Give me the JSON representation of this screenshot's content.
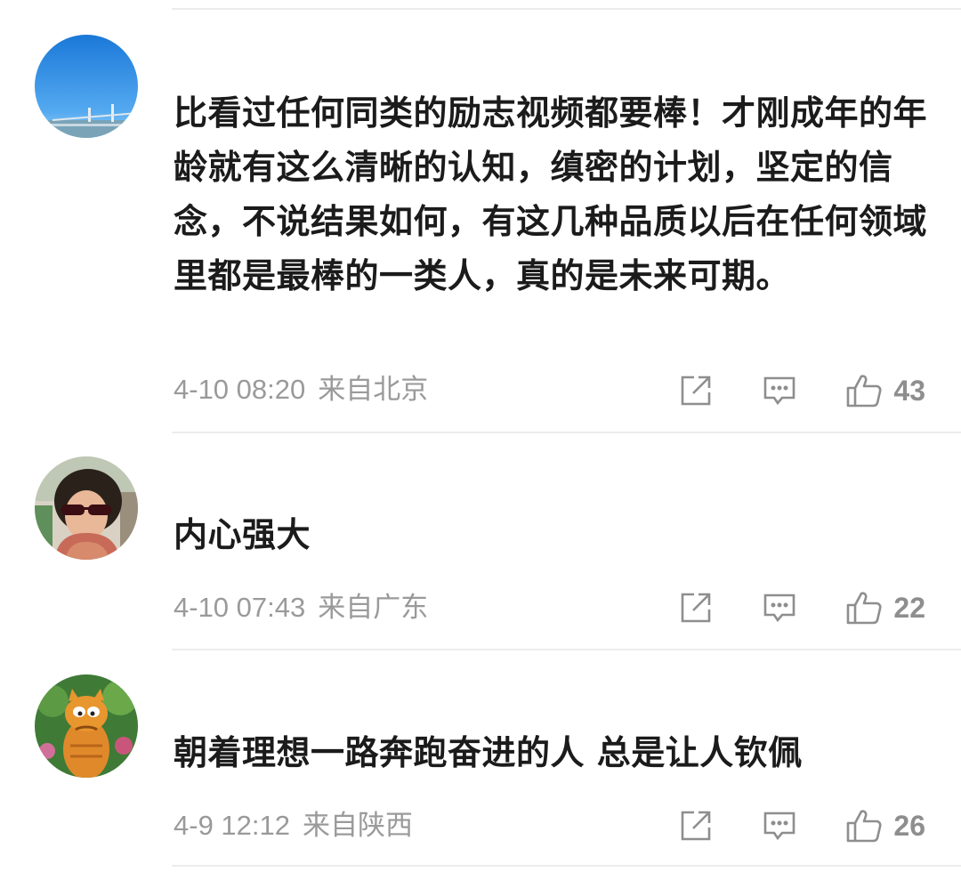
{
  "comments": [
    {
      "avatar": "sky-bridge-photo",
      "text": "比看过任何同类的励志视频都要棒！才刚成年的年龄就有这么清晰的认知，缜密的计划，坚定的信念，不说结果如何，有这几种品质以后在任何领域里都是最棒的一类人，真的是未来可期。",
      "time": "4-10 08:20",
      "location": "来自北京",
      "likes": "43"
    },
    {
      "avatar": "girl-with-sunglasses-photo",
      "text": "内心强大",
      "time": "4-10 07:43",
      "location": "来自广东",
      "likes": "22"
    },
    {
      "avatar": "garfield-cat-photo",
      "text": "朝着理想一路奔跑奋进的人 总是让人钦佩",
      "time": "4-9 12:12",
      "location": "来自陕西",
      "likes": "26"
    }
  ],
  "icons": {
    "share": "share-icon",
    "reply": "comment-icon",
    "like": "thumbs-up-icon"
  },
  "colors": {
    "text": "#1b1b1b",
    "meta": "#9a9a9a",
    "icon": "#8e8e8e",
    "divider": "#ececec"
  }
}
